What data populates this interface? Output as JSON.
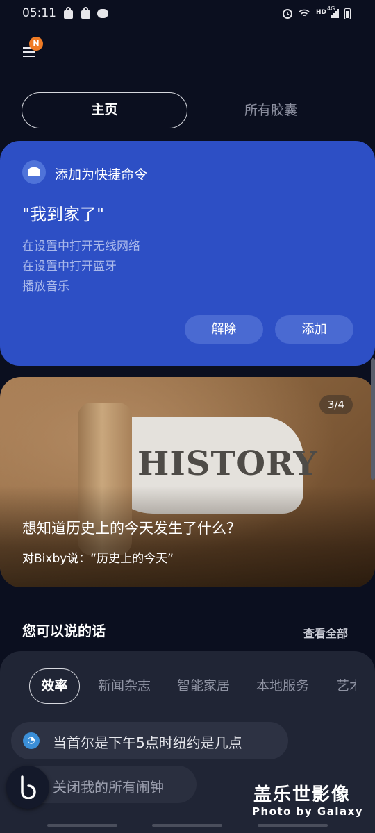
{
  "status_bar": {
    "time": "05:11",
    "signal_label": "HD",
    "network_label": "4G",
    "icons": [
      "shopping-bag-icon",
      "shopping-bag-icon",
      "wechat-icon",
      "alarm-icon",
      "wifi-icon",
      "signal-icon",
      "battery-icon"
    ]
  },
  "header": {
    "notification_badge": "N"
  },
  "tabs": [
    {
      "label": "主页",
      "selected": true
    },
    {
      "label": "所有胶囊",
      "selected": false
    }
  ],
  "shortcut_card": {
    "header": "添加为快捷命令",
    "phrase": "\"我到家了\"",
    "steps": [
      "在设置中打开无线网络",
      "在设置中打开蓝牙",
      "播放音乐"
    ],
    "dismiss_label": "解除",
    "add_label": "添加",
    "color": "#2d4fc5"
  },
  "history_card": {
    "image_text": "HISTORY",
    "page_indicator": "3/4",
    "question": "想知道历史上的今天发生了什么？",
    "hint": "对Bixby说：“历史上的今天”"
  },
  "suggestions": {
    "title": "您可以说的话",
    "view_all": "查看全部",
    "categories": [
      "效率",
      "新闻杂志",
      "智能家居",
      "本地服务",
      "艺术"
    ],
    "selected_category": "效率",
    "items": [
      {
        "text": "当首尔是下午5点时纽约是几点",
        "icon": "clock-app-icon"
      },
      {
        "text": "关闭我的所有闹钟"
      }
    ]
  },
  "watermark": {
    "title": "盖乐世影像",
    "subtitle": "Photo by Galaxy"
  }
}
